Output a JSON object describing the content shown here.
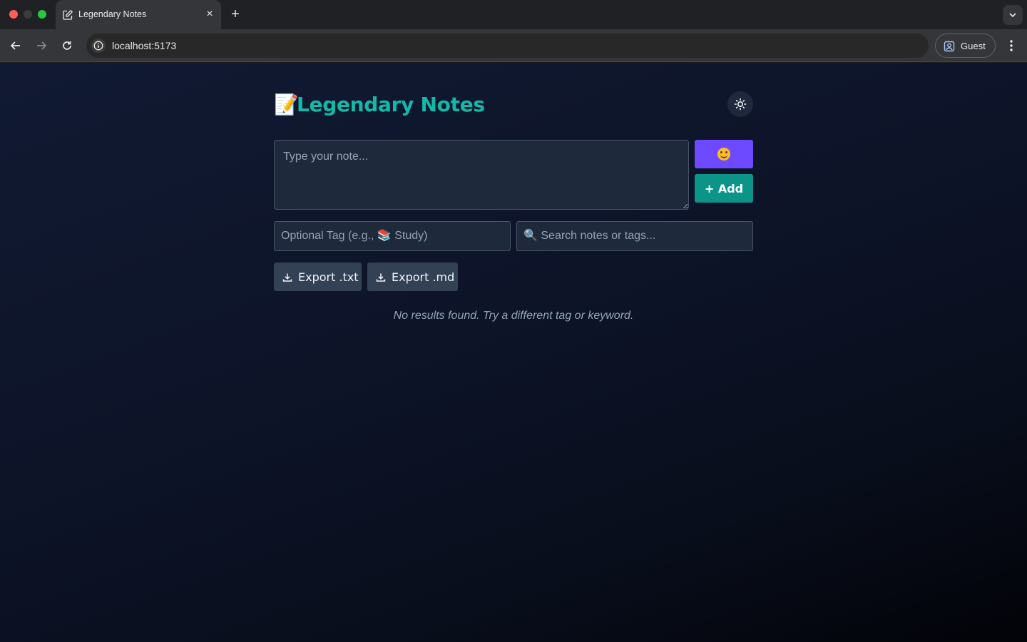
{
  "browser": {
    "tab_title": "Legendary Notes",
    "tab_close": "×",
    "new_tab": "+",
    "url": "localhost:5173",
    "profile_label": "Guest"
  },
  "app": {
    "title_emoji": "📝",
    "title": "Legendary Notes",
    "accent_color": "#14b8a6",
    "note_placeholder": "Type your note...",
    "emoji_button_icon": "smiling-face-emoji",
    "add_label": "+ Add",
    "tag_placeholder": "Optional Tag (e.g., 📚 Study)",
    "search_placeholder": "🔍 Search notes or tags...",
    "export_txt_label": "Export .txt",
    "export_md_label": "Export .md",
    "empty_message": "No results found. Try a different tag or keyword."
  }
}
